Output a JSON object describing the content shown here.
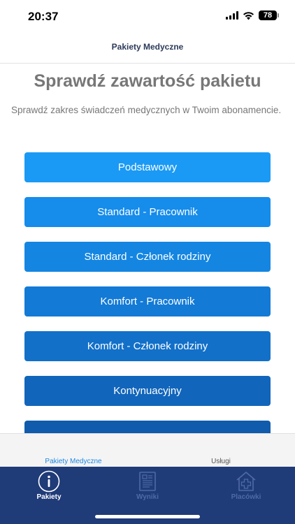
{
  "status_bar": {
    "time": "20:37",
    "battery": "78",
    "icons": [
      "signal-icon",
      "wifi-icon",
      "battery-icon"
    ]
  },
  "nav": {
    "title": "Pakiety Medyczne"
  },
  "main": {
    "title": "Sprawdź zawartość pakietu",
    "subtitle": "Sprawdź zakres świadczeń medycznych w Twoim abonamencie.",
    "packages": [
      {
        "label": "Podstawowy",
        "color": "#1a9af5"
      },
      {
        "label": "Standard - Pracownik",
        "color": "#168ceb"
      },
      {
        "label": "Standard - Członek rodziny",
        "color": "#1486e2"
      },
      {
        "label": "Komfort - Pracownik",
        "color": "#137ad6"
      },
      {
        "label": "Komfort - Członek rodziny",
        "color": "#1270c9"
      },
      {
        "label": "Kontynuacyjny",
        "color": "#1165bb"
      },
      {
        "label": "",
        "color": "#105bac"
      }
    ]
  },
  "segments": {
    "left": "Pakiety Medyczne",
    "right": "Usługi"
  },
  "tabs": [
    {
      "label": "Pakiety",
      "icon": "info-icon",
      "active": true
    },
    {
      "label": "Wyniki",
      "icon": "document-icon",
      "active": false
    },
    {
      "label": "Placówki",
      "icon": "clinic-icon",
      "active": false
    }
  ],
  "colors": {
    "tab_bar": "#1f3b78",
    "accent": "#1e88e5"
  }
}
